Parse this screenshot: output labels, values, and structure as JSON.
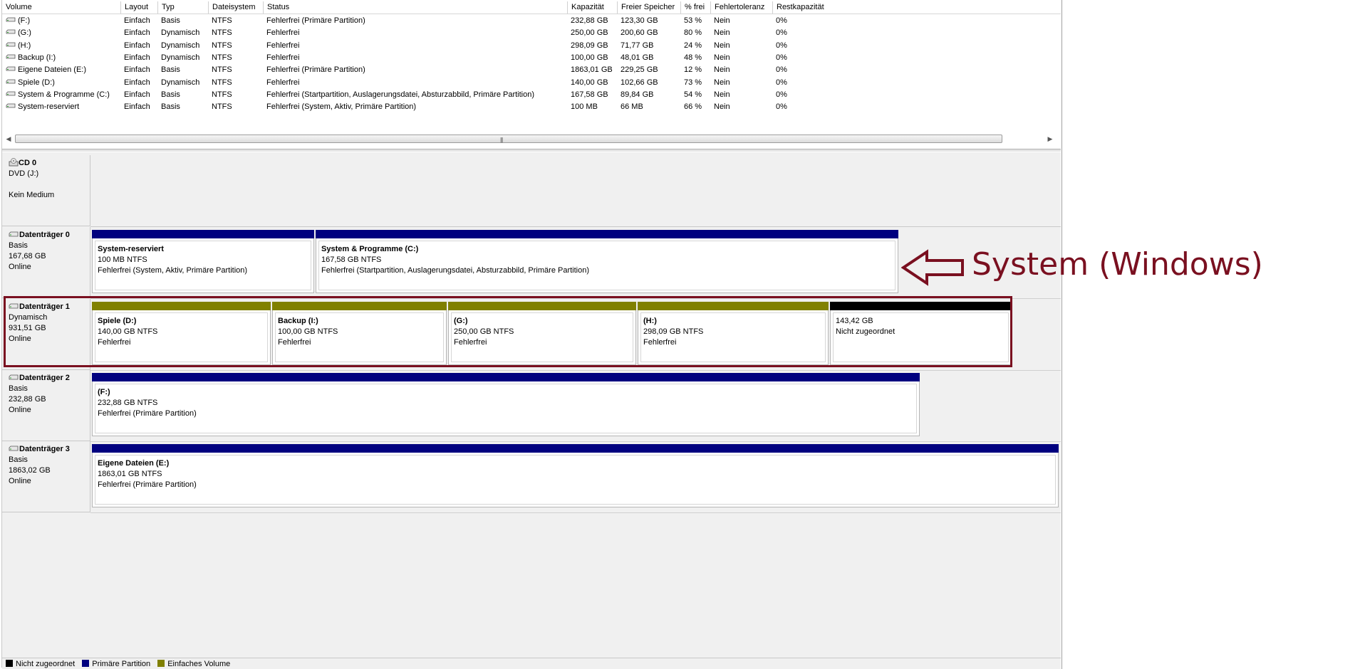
{
  "columns": [
    "Volume",
    "Layout",
    "Typ",
    "Dateisystem",
    "Status",
    "Kapazität",
    "Freier Speicher",
    "% frei",
    "Fehlertoleranz",
    "Restkapazität"
  ],
  "volumes": [
    {
      "volume": "(F:)",
      "layout": "Einfach",
      "typ": "Basis",
      "fs": "NTFS",
      "status": "Fehlerfrei (Primäre Partition)",
      "kapazitaet": "232,88 GB",
      "frei": "123,30 GB",
      "prozent": "53 %",
      "fehlertoleranz": "Nein",
      "rest": "0%"
    },
    {
      "volume": "(G:)",
      "layout": "Einfach",
      "typ": "Dynamisch",
      "fs": "NTFS",
      "status": "Fehlerfrei",
      "kapazitaet": "250,00 GB",
      "frei": "200,60 GB",
      "prozent": "80 %",
      "fehlertoleranz": "Nein",
      "rest": "0%"
    },
    {
      "volume": "(H:)",
      "layout": "Einfach",
      "typ": "Dynamisch",
      "fs": "NTFS",
      "status": "Fehlerfrei",
      "kapazitaet": "298,09 GB",
      "frei": "71,77 GB",
      "prozent": "24 %",
      "fehlertoleranz": "Nein",
      "rest": "0%"
    },
    {
      "volume": "Backup (I:)",
      "layout": "Einfach",
      "typ": "Dynamisch",
      "fs": "NTFS",
      "status": "Fehlerfrei",
      "kapazitaet": "100,00 GB",
      "frei": "48,01 GB",
      "prozent": "48 %",
      "fehlertoleranz": "Nein",
      "rest": "0%"
    },
    {
      "volume": "Eigene Dateien (E:)",
      "layout": "Einfach",
      "typ": "Basis",
      "fs": "NTFS",
      "status": "Fehlerfrei (Primäre Partition)",
      "kapazitaet": "1863,01 GB",
      "frei": "229,25 GB",
      "prozent": "12 %",
      "fehlertoleranz": "Nein",
      "rest": "0%"
    },
    {
      "volume": "Spiele (D:)",
      "layout": "Einfach",
      "typ": "Dynamisch",
      "fs": "NTFS",
      "status": "Fehlerfrei",
      "kapazitaet": "140,00 GB",
      "frei": "102,66 GB",
      "prozent": "73 %",
      "fehlertoleranz": "Nein",
      "rest": "0%"
    },
    {
      "volume": "System & Programme (C:)",
      "layout": "Einfach",
      "typ": "Basis",
      "fs": "NTFS",
      "status": "Fehlerfrei (Startpartition, Auslagerungsdatei, Absturzabbild, Primäre Partition)",
      "kapazitaet": "167,58 GB",
      "frei": "89,84 GB",
      "prozent": "54 %",
      "fehlertoleranz": "Nein",
      "rest": "0%"
    },
    {
      "volume": "System-reserviert",
      "layout": "Einfach",
      "typ": "Basis",
      "fs": "NTFS",
      "status": "Fehlerfrei (System, Aktiv, Primäre Partition)",
      "kapazitaet": "100 MB",
      "frei": "66 MB",
      "prozent": "66 %",
      "fehlertoleranz": "Nein",
      "rest": "0%"
    }
  ],
  "scrollbar_grip": "|||",
  "cd": {
    "name": "CD 0",
    "line1": "DVD (J:)",
    "line2": "Kein Medium"
  },
  "disks": [
    {
      "name": "Datenträger 0",
      "type": "Basis",
      "size": "167,68 GB",
      "state": "Online",
      "partitions": [
        {
          "name": "System-reserviert",
          "size": "100 MB NTFS",
          "status": "Fehlerfrei (System, Aktiv, Primäre Partition)",
          "kind": "primary"
        },
        {
          "name": "System & Programme  (C:)",
          "size": "167,58 GB NTFS",
          "status": "Fehlerfrei (Startpartition, Auslagerungsdatei, Absturzabbild, Primäre Partition)",
          "kind": "primary"
        }
      ]
    },
    {
      "name": "Datenträger 1",
      "type": "Dynamisch",
      "size": "931,51 GB",
      "state": "Online",
      "partitions": [
        {
          "name": "Spiele  (D:)",
          "size": "140,00 GB NTFS",
          "status": "Fehlerfrei",
          "kind": "simple"
        },
        {
          "name": "Backup  (I:)",
          "size": "100,00 GB NTFS",
          "status": "Fehlerfrei",
          "kind": "simple"
        },
        {
          "name": "(G:)",
          "size": "250,00 GB NTFS",
          "status": "Fehlerfrei",
          "kind": "simple"
        },
        {
          "name": "(H:)",
          "size": "298,09 GB NTFS",
          "status": "Fehlerfrei",
          "kind": "simple"
        },
        {
          "name": "",
          "size": "143,42 GB",
          "status": "Nicht zugeordnet",
          "kind": "unallocated"
        }
      ]
    },
    {
      "name": "Datenträger 2",
      "type": "Basis",
      "size": "232,88 GB",
      "state": "Online",
      "partitions": [
        {
          "name": "(F:)",
          "size": "232,88 GB NTFS",
          "status": "Fehlerfrei (Primäre Partition)",
          "kind": "primary"
        }
      ]
    },
    {
      "name": "Datenträger 3",
      "type": "Basis",
      "size": "1863,02 GB",
      "state": "Online",
      "partitions": [
        {
          "name": "Eigene Dateien  (E:)",
          "size": "1863,01 GB NTFS",
          "status": "Fehlerfrei (Primäre Partition)",
          "kind": "primary"
        }
      ]
    }
  ],
  "annotation": "System (Windows)",
  "legend": [
    {
      "label": "Nicht zugeordnet",
      "color": "#000000"
    },
    {
      "label": "Primäre Partition",
      "color": "#00007f"
    },
    {
      "label": "Einfaches Volume",
      "color": "#808000"
    }
  ],
  "colors": {
    "primary": "#00007f",
    "simple": "#808000",
    "unallocated": "#000000",
    "annotation": "#7a1020"
  }
}
